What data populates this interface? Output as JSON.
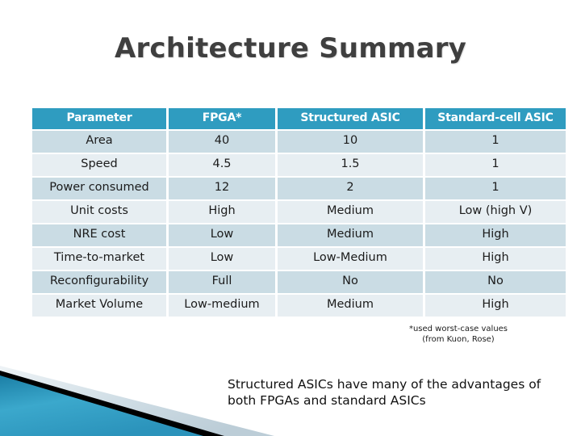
{
  "slide": {
    "title": "Architecture Summary",
    "title_color": "#3f3f3f",
    "background": "#ffffff"
  },
  "theme": {
    "header_fill": "#2f9cc0",
    "header_text": "#ffffff",
    "row_odd_fill": "#cadce4",
    "row_even_fill": "#e7eef2",
    "body_text": "#1b1b1b",
    "accent_teal": "#2f9cc0",
    "accent_dark": "#000000",
    "accent_pale": "#d6e3e9"
  },
  "table": {
    "columns": [
      "Parameter",
      "FPGA*",
      "Structured ASIC",
      "Standard-cell ASIC"
    ],
    "rows": [
      {
        "parameter": "Area",
        "fpga": "40",
        "structured": "10",
        "standard": "1"
      },
      {
        "parameter": "Speed",
        "fpga": "4.5",
        "structured": "1.5",
        "standard": "1"
      },
      {
        "parameter": "Power consumed",
        "fpga": "12",
        "structured": "2",
        "standard": "1"
      },
      {
        "parameter": "Unit costs",
        "fpga": "High",
        "structured": "Medium",
        "standard": "Low (high V)"
      },
      {
        "parameter": "NRE cost",
        "fpga": "Low",
        "structured": "Medium",
        "standard": "High"
      },
      {
        "parameter": "Time-to-market",
        "fpga": "Low",
        "structured": "Low-Medium",
        "standard": "High"
      },
      {
        "parameter": "Reconfigurability",
        "fpga": "Full",
        "structured": "No",
        "standard": "No"
      },
      {
        "parameter": "Market Volume",
        "fpga": "Low-medium",
        "structured": "Medium",
        "standard": "High"
      }
    ]
  },
  "footnote": {
    "line1": "*used worst-case values",
    "line2": "(from Kuon, Rose)"
  },
  "caption": {
    "line1": "Structured ASICs have many of the advantages of",
    "line2": "both FPGAs and standard ASICs"
  },
  "decoration": {
    "name": "bottom-left-diagonal-banner"
  }
}
